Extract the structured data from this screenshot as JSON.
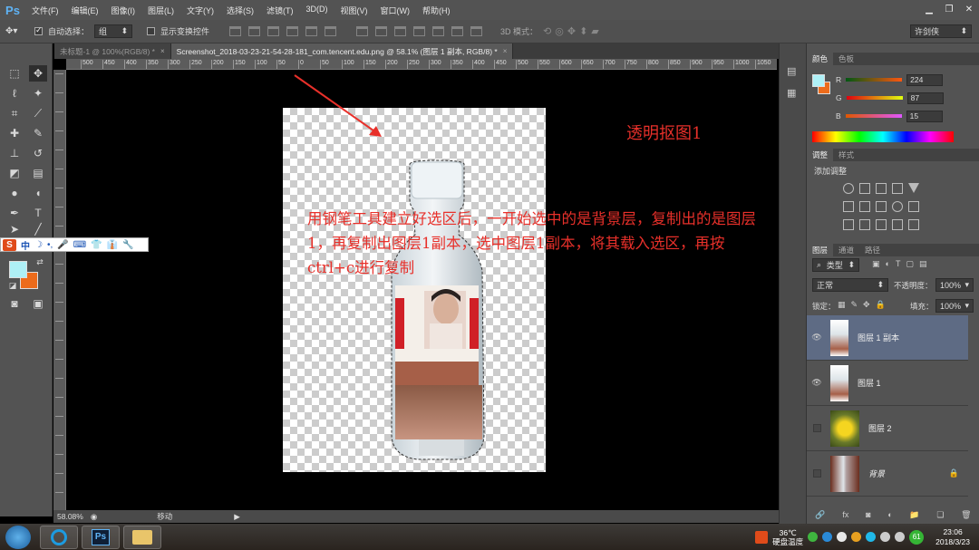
{
  "app": {
    "logo": "Ps"
  },
  "menu": [
    "文件(F)",
    "编辑(E)",
    "图像(I)",
    "图层(L)",
    "文字(Y)",
    "选择(S)",
    "滤镜(T)",
    "3D(D)",
    "视图(V)",
    "窗口(W)",
    "帮助(H)"
  ],
  "window_controls": {
    "minimize": "▁",
    "restore": "❐",
    "close": "✕"
  },
  "options": {
    "auto_select_label": "自动选择：",
    "auto_select_value": "组",
    "show_transform_label": "显示变换控件",
    "mode_3d_label": "3D 模式：",
    "workspace": "许剑侠"
  },
  "tabs": [
    {
      "label": "未标题-1 @ 100%(RGB/8) *",
      "close": "×"
    },
    {
      "label": "Screenshot_2018-03-23-21-54-28-181_com.tencent.edu.png @ 58.1% (图层 1 副本, RGB/8) *",
      "close": "×"
    }
  ],
  "ruler": {
    "h_labels": [
      "500",
      "450",
      "400",
      "350",
      "300",
      "250",
      "200",
      "150",
      "100",
      "50",
      "0",
      "50",
      "100",
      "150",
      "200",
      "250",
      "300",
      "350",
      "400",
      "450",
      "500",
      "550",
      "600",
      "650",
      "700",
      "750",
      "800",
      "850",
      "900",
      "950",
      "1000",
      "1050",
      "1100",
      "1150"
    ],
    "v_labels": [
      "0",
      "50",
      "100",
      "150",
      "200",
      "250",
      "300",
      "350",
      "400",
      "450",
      "500",
      "550",
      "600",
      "650",
      "700",
      "750",
      "800",
      "850",
      "900",
      "950",
      "1000",
      "1050",
      "1100"
    ]
  },
  "annotations": {
    "title": "透明抠图1",
    "body": "用钢笔工具建立好选区后，一开始选中的是背景层，复制出的是图层1，再复制出图层1副本，选中图层1副本，将其载入选区，再按ctrl+c进行复制"
  },
  "ime": {
    "logo": "S",
    "mode": "中",
    "icons": [
      "☽",
      "•,",
      "🎤",
      "⌨",
      "👕",
      "👔",
      "🔧"
    ]
  },
  "status": {
    "zoom": "58.08%",
    "tool_name": "移动",
    "arrow": "▶"
  },
  "color_panel": {
    "tabs": [
      "颜色",
      "色板"
    ],
    "r_label": "R",
    "r_value": "224",
    "g_label": "G",
    "g_value": "87",
    "b_label": "B",
    "b_value": "15",
    "fg_color": "#aef0f6",
    "bg_color": "#ec6b1b"
  },
  "adjust_panel": {
    "tabs": [
      "调整",
      "样式"
    ],
    "title": "添加调整"
  },
  "layers_panel": {
    "tabs": [
      "图层",
      "通道",
      "路径"
    ],
    "filter_label": "类型",
    "blend_mode": "正常",
    "opacity_label": "不透明度：",
    "opacity_value": "100%",
    "lock_label": "锁定：",
    "fill_label": "填充：",
    "fill_value": "100%",
    "layers": [
      {
        "name": "图层 1 副本",
        "visible": true,
        "active": true
      },
      {
        "name": "图层 1",
        "visible": true,
        "active": false
      },
      {
        "name": "图层 2",
        "visible": false,
        "active": false
      },
      {
        "name": "背景",
        "visible": false,
        "active": false,
        "locked": true
      }
    ],
    "footer_icons": [
      "🔗",
      "fx",
      "◙",
      "◐",
      "📁",
      "❏",
      "🗑"
    ]
  },
  "taskbar": {
    "ps_label": "Ps",
    "temp_value": "36℃",
    "temp_label": "硬盘温度",
    "badge": "61",
    "time": "23:06",
    "date": "2018/3/23"
  }
}
